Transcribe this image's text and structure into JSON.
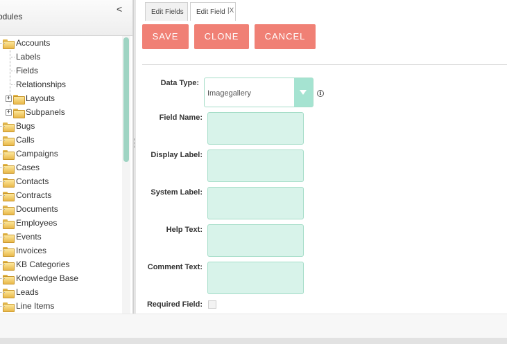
{
  "sidebar": {
    "title": "odules",
    "collapse_icon": "<",
    "tree": [
      {
        "label": "Accounts",
        "level": 0,
        "type": "folder-open"
      },
      {
        "label": "Labels",
        "level": 1,
        "type": "leaf"
      },
      {
        "label": "Fields",
        "level": 1,
        "type": "leaf"
      },
      {
        "label": "Relationships",
        "level": 1,
        "type": "leaf"
      },
      {
        "label": "Layouts",
        "level": 1,
        "type": "folder-expandable"
      },
      {
        "label": "Subpanels",
        "level": 1,
        "type": "folder-expandable"
      },
      {
        "label": "Bugs",
        "level": 0,
        "type": "folder"
      },
      {
        "label": "Calls",
        "level": 0,
        "type": "folder"
      },
      {
        "label": "Campaigns",
        "level": 0,
        "type": "folder"
      },
      {
        "label": "Cases",
        "level": 0,
        "type": "folder"
      },
      {
        "label": "Contacts",
        "level": 0,
        "type": "folder"
      },
      {
        "label": "Contracts",
        "level": 0,
        "type": "folder"
      },
      {
        "label": "Documents",
        "level": 0,
        "type": "folder"
      },
      {
        "label": "Employees",
        "level": 0,
        "type": "folder"
      },
      {
        "label": "Events",
        "level": 0,
        "type": "folder"
      },
      {
        "label": "Invoices",
        "level": 0,
        "type": "folder"
      },
      {
        "label": "KB Categories",
        "level": 0,
        "type": "folder"
      },
      {
        "label": "Knowledge Base",
        "level": 0,
        "type": "folder"
      },
      {
        "label": "Leads",
        "level": 0,
        "type": "folder"
      },
      {
        "label": "Line Items",
        "level": 0,
        "type": "folder"
      }
    ]
  },
  "tabs": [
    {
      "label": "Edit Fields"
    },
    {
      "label": "Edit Field",
      "close": "|X"
    }
  ],
  "buttons": {
    "save": "SAVE",
    "clone": "CLONE",
    "cancel": "CANCEL"
  },
  "form": {
    "data_type_label": "Data Type:",
    "data_type_value": "Imagegallery",
    "info_icon": "i",
    "fields": [
      {
        "label": "Field Name:",
        "value": ""
      },
      {
        "label": "Display Label:",
        "value": ""
      },
      {
        "label": "System Label:",
        "value": ""
      },
      {
        "label": "Help Text:",
        "value": ""
      },
      {
        "label": "Comment Text:",
        "value": ""
      }
    ],
    "required_label": "Required Field:"
  },
  "colors": {
    "button_bg": "#f08075",
    "input_bg": "#d8f3ea",
    "accent": "#a5e3d1",
    "scroll_thumb": "#9fd4c3"
  }
}
